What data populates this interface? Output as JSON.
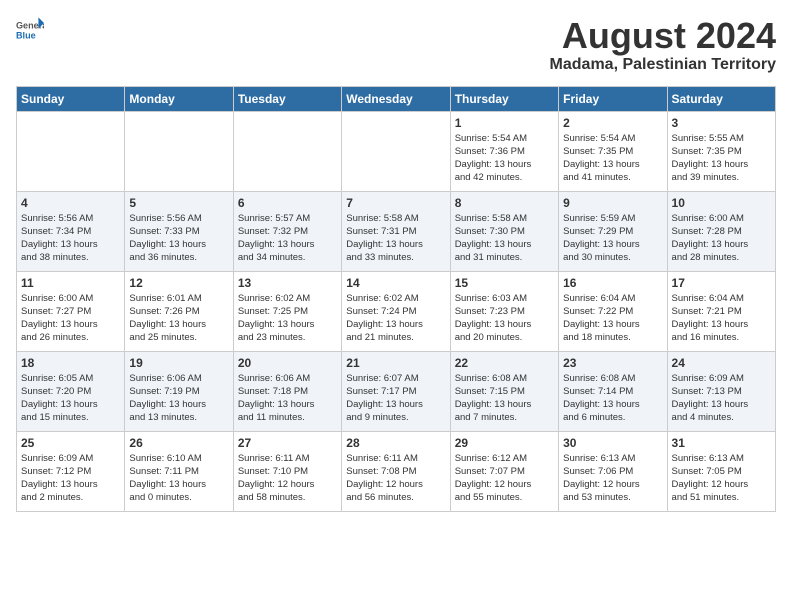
{
  "logo": {
    "text_general": "General",
    "text_blue": "Blue"
  },
  "title": "August 2024",
  "subtitle": "Madama, Palestinian Territory",
  "days_of_week": [
    "Sunday",
    "Monday",
    "Tuesday",
    "Wednesday",
    "Thursday",
    "Friday",
    "Saturday"
  ],
  "weeks": [
    {
      "days": [
        {
          "num": "",
          "info": ""
        },
        {
          "num": "",
          "info": ""
        },
        {
          "num": "",
          "info": ""
        },
        {
          "num": "",
          "info": ""
        },
        {
          "num": "1",
          "info": "Sunrise: 5:54 AM\nSunset: 7:36 PM\nDaylight: 13 hours\nand 42 minutes."
        },
        {
          "num": "2",
          "info": "Sunrise: 5:54 AM\nSunset: 7:35 PM\nDaylight: 13 hours\nand 41 minutes."
        },
        {
          "num": "3",
          "info": "Sunrise: 5:55 AM\nSunset: 7:35 PM\nDaylight: 13 hours\nand 39 minutes."
        }
      ]
    },
    {
      "days": [
        {
          "num": "4",
          "info": "Sunrise: 5:56 AM\nSunset: 7:34 PM\nDaylight: 13 hours\nand 38 minutes."
        },
        {
          "num": "5",
          "info": "Sunrise: 5:56 AM\nSunset: 7:33 PM\nDaylight: 13 hours\nand 36 minutes."
        },
        {
          "num": "6",
          "info": "Sunrise: 5:57 AM\nSunset: 7:32 PM\nDaylight: 13 hours\nand 34 minutes."
        },
        {
          "num": "7",
          "info": "Sunrise: 5:58 AM\nSunset: 7:31 PM\nDaylight: 13 hours\nand 33 minutes."
        },
        {
          "num": "8",
          "info": "Sunrise: 5:58 AM\nSunset: 7:30 PM\nDaylight: 13 hours\nand 31 minutes."
        },
        {
          "num": "9",
          "info": "Sunrise: 5:59 AM\nSunset: 7:29 PM\nDaylight: 13 hours\nand 30 minutes."
        },
        {
          "num": "10",
          "info": "Sunrise: 6:00 AM\nSunset: 7:28 PM\nDaylight: 13 hours\nand 28 minutes."
        }
      ]
    },
    {
      "days": [
        {
          "num": "11",
          "info": "Sunrise: 6:00 AM\nSunset: 7:27 PM\nDaylight: 13 hours\nand 26 minutes."
        },
        {
          "num": "12",
          "info": "Sunrise: 6:01 AM\nSunset: 7:26 PM\nDaylight: 13 hours\nand 25 minutes."
        },
        {
          "num": "13",
          "info": "Sunrise: 6:02 AM\nSunset: 7:25 PM\nDaylight: 13 hours\nand 23 minutes."
        },
        {
          "num": "14",
          "info": "Sunrise: 6:02 AM\nSunset: 7:24 PM\nDaylight: 13 hours\nand 21 minutes."
        },
        {
          "num": "15",
          "info": "Sunrise: 6:03 AM\nSunset: 7:23 PM\nDaylight: 13 hours\nand 20 minutes."
        },
        {
          "num": "16",
          "info": "Sunrise: 6:04 AM\nSunset: 7:22 PM\nDaylight: 13 hours\nand 18 minutes."
        },
        {
          "num": "17",
          "info": "Sunrise: 6:04 AM\nSunset: 7:21 PM\nDaylight: 13 hours\nand 16 minutes."
        }
      ]
    },
    {
      "days": [
        {
          "num": "18",
          "info": "Sunrise: 6:05 AM\nSunset: 7:20 PM\nDaylight: 13 hours\nand 15 minutes."
        },
        {
          "num": "19",
          "info": "Sunrise: 6:06 AM\nSunset: 7:19 PM\nDaylight: 13 hours\nand 13 minutes."
        },
        {
          "num": "20",
          "info": "Sunrise: 6:06 AM\nSunset: 7:18 PM\nDaylight: 13 hours\nand 11 minutes."
        },
        {
          "num": "21",
          "info": "Sunrise: 6:07 AM\nSunset: 7:17 PM\nDaylight: 13 hours\nand 9 minutes."
        },
        {
          "num": "22",
          "info": "Sunrise: 6:08 AM\nSunset: 7:15 PM\nDaylight: 13 hours\nand 7 minutes."
        },
        {
          "num": "23",
          "info": "Sunrise: 6:08 AM\nSunset: 7:14 PM\nDaylight: 13 hours\nand 6 minutes."
        },
        {
          "num": "24",
          "info": "Sunrise: 6:09 AM\nSunset: 7:13 PM\nDaylight: 13 hours\nand 4 minutes."
        }
      ]
    },
    {
      "days": [
        {
          "num": "25",
          "info": "Sunrise: 6:09 AM\nSunset: 7:12 PM\nDaylight: 13 hours\nand 2 minutes."
        },
        {
          "num": "26",
          "info": "Sunrise: 6:10 AM\nSunset: 7:11 PM\nDaylight: 13 hours\nand 0 minutes."
        },
        {
          "num": "27",
          "info": "Sunrise: 6:11 AM\nSunset: 7:10 PM\nDaylight: 12 hours\nand 58 minutes."
        },
        {
          "num": "28",
          "info": "Sunrise: 6:11 AM\nSunset: 7:08 PM\nDaylight: 12 hours\nand 56 minutes."
        },
        {
          "num": "29",
          "info": "Sunrise: 6:12 AM\nSunset: 7:07 PM\nDaylight: 12 hours\nand 55 minutes."
        },
        {
          "num": "30",
          "info": "Sunrise: 6:13 AM\nSunset: 7:06 PM\nDaylight: 12 hours\nand 53 minutes."
        },
        {
          "num": "31",
          "info": "Sunrise: 6:13 AM\nSunset: 7:05 PM\nDaylight: 12 hours\nand 51 minutes."
        }
      ]
    }
  ]
}
